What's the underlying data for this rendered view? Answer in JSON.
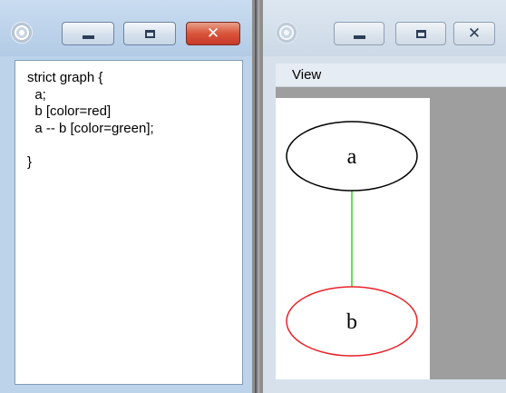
{
  "editor_window": {
    "code_lines": [
      "strict graph {",
      "  a;",
      "  b [color=red]",
      "  a -- b [color=green];",
      "",
      "}"
    ],
    "close_glyph": "✕"
  },
  "viewer_window": {
    "menu": {
      "view_label": "View"
    },
    "close_glyph": "✕",
    "graph": {
      "nodes": [
        {
          "id": "a",
          "label": "a",
          "color": "#000000"
        },
        {
          "id": "b",
          "label": "b",
          "color": "#e8232b"
        }
      ],
      "edges": [
        {
          "from": "a",
          "to": "b",
          "color": "#2dd61d"
        }
      ]
    }
  },
  "colors": {
    "close_button": "#d4452f",
    "titlebar_active": "#bcd3ea",
    "titlebar_inactive": "#d6e1ec"
  }
}
